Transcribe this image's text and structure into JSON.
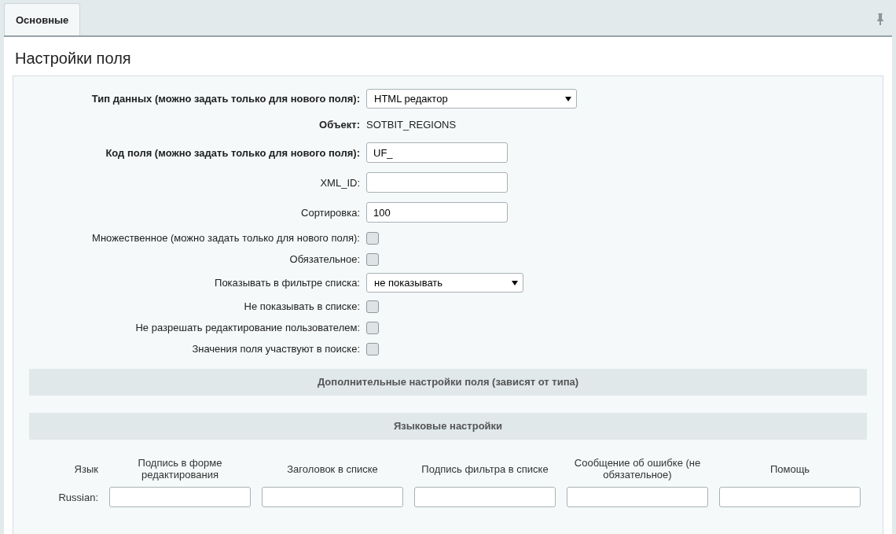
{
  "tabs": [
    {
      "label": "Основные",
      "selected": true
    }
  ],
  "title": "Настройки поля",
  "fields": [
    {
      "kind": "select",
      "label": "Тип данных (можно задать только для нового поля):",
      "bold": true,
      "value": "HTML редактор",
      "wide": true
    },
    {
      "kind": "text",
      "label": "Объект:",
      "bold": true,
      "value": "SOTBIT_REGIONS"
    },
    {
      "kind": "input",
      "label": "Код поля (можно задать только для нового поля):",
      "bold": true,
      "value": "UF_"
    },
    {
      "kind": "input",
      "label": "XML_ID:",
      "bold": false
    },
    {
      "kind": "input",
      "label": "Сортировка:",
      "bold": false,
      "value": "100"
    },
    {
      "kind": "checkbox",
      "label": "Множественное (можно задать только для нового поля):",
      "bold": false,
      "checked": false
    },
    {
      "kind": "checkbox",
      "label": "Обязательное:",
      "bold": false,
      "checked": false
    },
    {
      "kind": "select",
      "label": "Показывать в фильтре списка:",
      "bold": false,
      "value": "не показывать",
      "wide": false
    },
    {
      "kind": "checkbox",
      "label": "Не показывать в списке:",
      "bold": false,
      "checked": false
    },
    {
      "kind": "checkbox",
      "label": "Не разрешать редактирование пользователем:",
      "bold": false,
      "checked": false
    },
    {
      "kind": "checkbox",
      "label": "Значения поля участвуют в поиске:",
      "bold": false,
      "checked": false
    }
  ],
  "sections": [
    "Дополнительные настройки поля (зависят от типа)",
    "Языковые настройки"
  ],
  "language_table": {
    "columns": [
      "Язык",
      "Подпись в форме редактирования",
      "Заголовок в списке",
      "Подпись фильтра в списке",
      "Сообщение об ошибке (не обязательное)",
      "Помощь"
    ],
    "rows": [
      {
        "language": "Russian:"
      }
    ]
  }
}
